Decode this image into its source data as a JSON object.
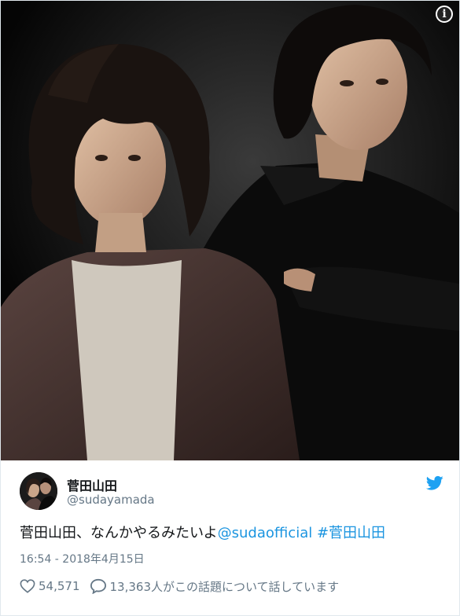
{
  "media": {
    "info_icon": "info-icon",
    "info_label": "i"
  },
  "author": {
    "display_name": "菅田山田",
    "handle": "@sudayamada",
    "avatar_icon": "avatar",
    "brand_icon": "twitter-bird-icon"
  },
  "tweet": {
    "text": "菅田山田、なんかやるみたいよ",
    "mention": "@sudaofficial",
    "hashtag": "#菅田山田",
    "timestamp": "16:54 - 2018年4月15日"
  },
  "actions": {
    "like_icon": "heart-icon",
    "like_count": "54,571",
    "reply_icon": "speech-bubble-icon",
    "conversation_text": "13,363人がこの話題について話しています"
  },
  "colors": {
    "link": "#1b95e0",
    "secondary_text": "#657786",
    "border": "#e1e8ed"
  }
}
